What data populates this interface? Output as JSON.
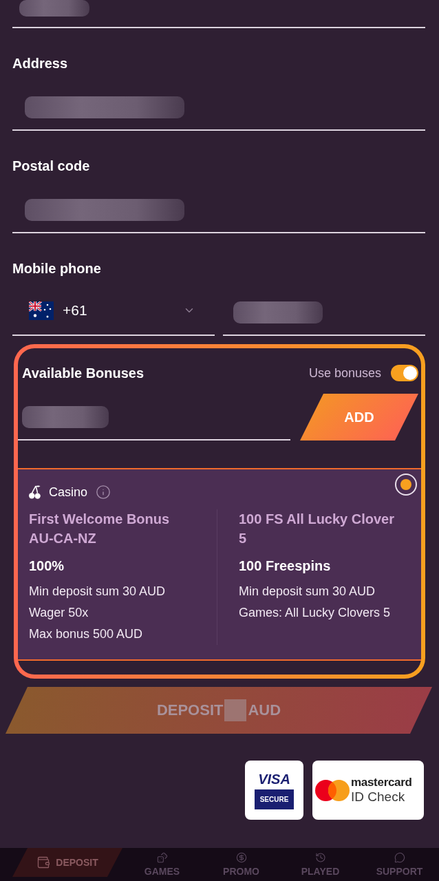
{
  "form": {
    "fields": [
      {
        "kind": "text",
        "redacted": true
      },
      {
        "kind": "text",
        "label": "Address",
        "redacted": true
      },
      {
        "kind": "text",
        "label": "Postal code",
        "redacted": true
      },
      {
        "kind": "phone",
        "label": "Mobile phone",
        "country_code": "+61",
        "redacted": true
      }
    ]
  },
  "bonuses": {
    "highlighted": true,
    "title": "Available Bonuses",
    "use_bonuses": {
      "label": "Use bonuses",
      "on": true
    },
    "promo_code": {
      "redacted": true
    },
    "add_button": "ADD",
    "cards": [
      {
        "category": "Casino",
        "selected": true,
        "offers": [
          {
            "title": "First Welcome Bonus AU-CA-NZ",
            "amount": "100%",
            "details": [
              "Min deposit sum 30 AUD",
              "Wager 50x",
              "Max bonus 500 AUD"
            ]
          },
          {
            "title": "100 FS All Lucky Clover 5",
            "amount": "100 Freespins",
            "details": [
              "Min deposit sum 30 AUD",
              "Games: All Lucky Clovers 5"
            ]
          }
        ]
      }
    ]
  },
  "deposit_button": {
    "label": "DEPOSIT",
    "amount_redacted": true,
    "currency": "AUD",
    "disabled": true
  },
  "payment_badges": [
    {
      "kind": "visa",
      "brand": "VISA",
      "caption": "SECURE"
    },
    {
      "kind": "mastercard",
      "brand": "mastercard",
      "caption": "ID Check"
    }
  ],
  "bottom_nav": {
    "dimmed": true,
    "items": [
      {
        "kind": "action",
        "label": "DEPOSIT"
      },
      {
        "kind": "tab",
        "label": "GAMES"
      },
      {
        "kind": "tab",
        "label": "PROMO"
      },
      {
        "kind": "tab",
        "label": "PLAYED"
      },
      {
        "kind": "tab",
        "label": "SUPPORT"
      }
    ]
  }
}
